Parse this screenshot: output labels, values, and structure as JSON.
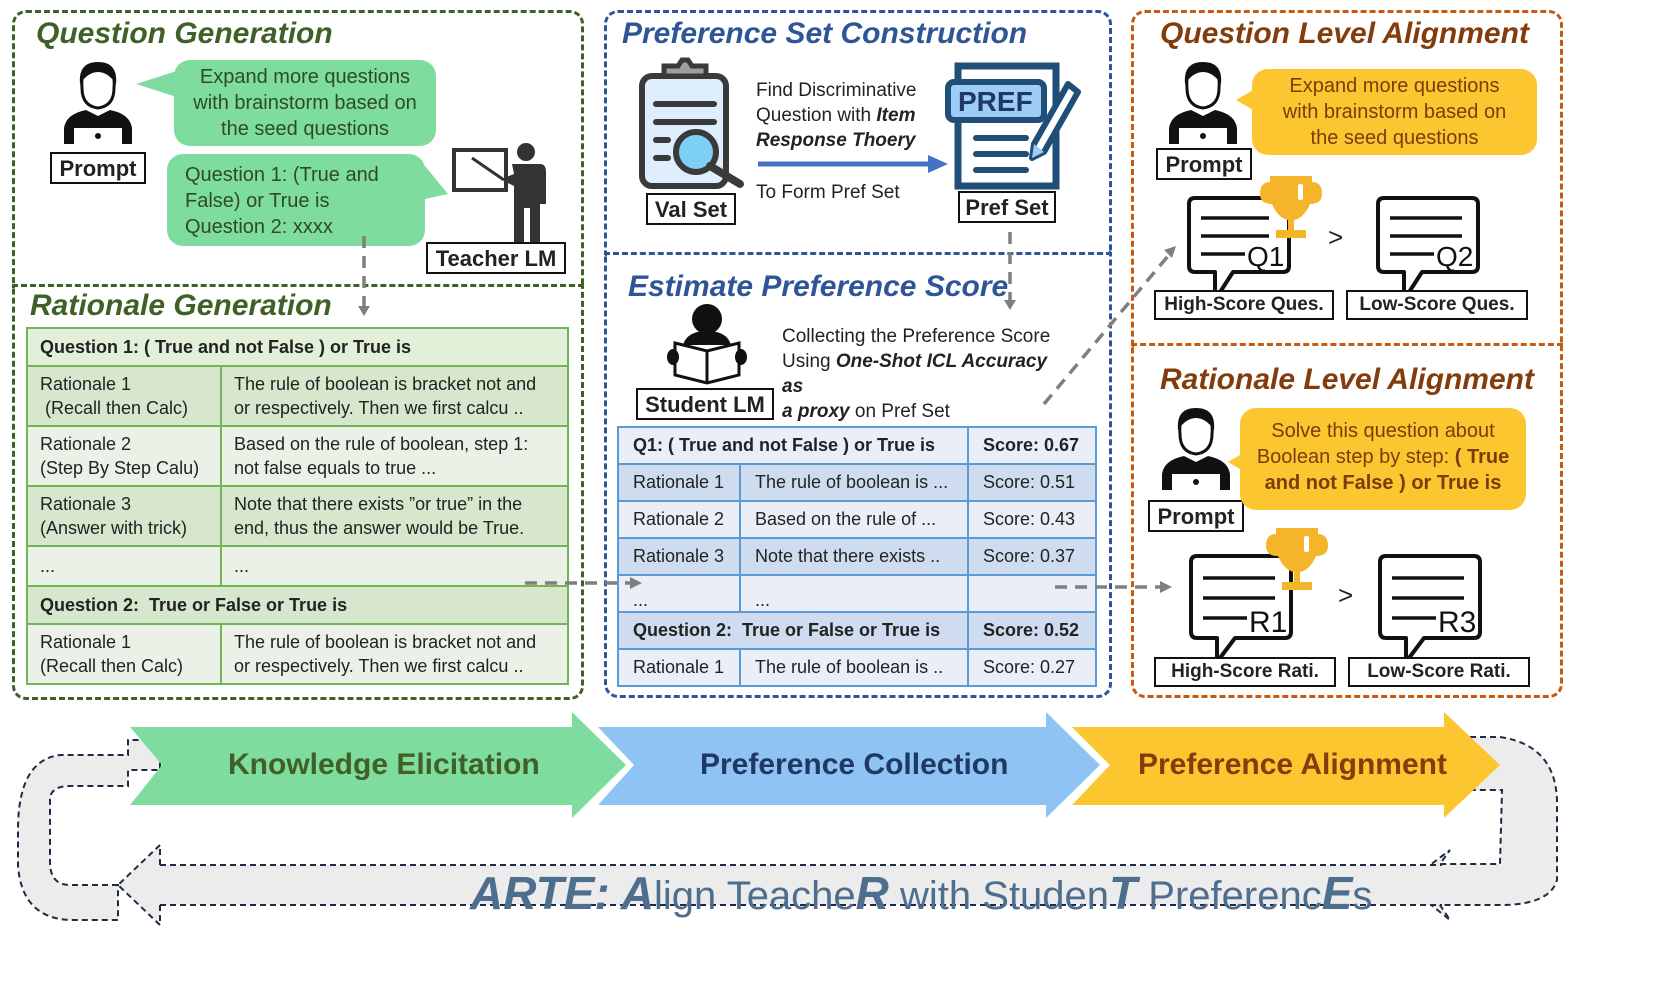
{
  "question_generation": {
    "title": "Question Generation",
    "prompt_label": "Prompt",
    "prompt_bubble": [
      "Expand more questions",
      "with brainstorm based on",
      "the seed questions"
    ],
    "teacher_bubble": [
      "Question 1: (True and",
      "False) or True is",
      "Question 2: xxxx"
    ],
    "teacher_label": "Teacher LM"
  },
  "rationale_generation": {
    "title": "Rationale Generation",
    "rows": [
      {
        "type": "header",
        "text": "Question 1: ( True and not False ) or True is"
      },
      {
        "type": "row",
        "name": [
          "Rationale 1",
          " (Recall then Calc)"
        ],
        "text": [
          "The rule of boolean is bracket not and",
          "or respectively. Then we first calcu .."
        ]
      },
      {
        "type": "row",
        "name": [
          "Rationale 2",
          "(Step By Step Calu)"
        ],
        "text": [
          "Based on the rule of boolean, step 1:",
          "not false equals to true ..."
        ]
      },
      {
        "type": "row",
        "name": [
          "Rationale 3",
          "(Answer with trick)"
        ],
        "text": [
          "Note that there exists ”or true” in the",
          "end, thus the answer would be True."
        ]
      },
      {
        "type": "row",
        "name": [
          "...",
          ""
        ],
        "text": [
          "...",
          ""
        ]
      },
      {
        "type": "header",
        "text": "Question 2:  True or False or True is"
      },
      {
        "type": "row",
        "name": [
          "Rationale 1",
          "(Recall then Calc)"
        ],
        "text": [
          "The rule of boolean is bracket not and",
          "or respectively. Then we first calcu .."
        ]
      }
    ]
  },
  "preference_set_construction": {
    "title": "Preference Set Construction",
    "val_set_label": "Val Set",
    "pref_set_label": "Pref Set",
    "pref_badge": "PREF",
    "arrow_text_line1": "Find Discriminative",
    "arrow_text_line2_plain": "Question with ",
    "arrow_text_line2_bold": "Item",
    "arrow_text_line3_bold": "Response Thoery",
    "arrow_text_below": "To Form Pref Set"
  },
  "estimate_preference_score": {
    "title": "Estimate Preference Score",
    "student_label": "Student LM",
    "desc_line1": "Collecting the Preference Score",
    "desc_line2_plain": "Using ",
    "desc_line2_bold": "One-Shot ICL Accuracy as",
    "desc_line3_bold": "a proxy",
    "desc_line3_plain": " on Pref Set",
    "rows": [
      {
        "type": "header",
        "text": "Q1: ( True and not False ) or True is",
        "score": "Score: 0.67"
      },
      {
        "type": "row",
        "name": "Rationale 1",
        "text": "The rule of boolean is ...",
        "score": "Score: 0.51"
      },
      {
        "type": "row",
        "name": "Rationale 2",
        "text": "Based on the rule of ...",
        "score": "Score: 0.43"
      },
      {
        "type": "row",
        "name": "Rationale 3",
        "text": "Note that there exists ..",
        "score": "Score: 0.37"
      },
      {
        "type": "row",
        "name": "...",
        "text": "...",
        "score": ""
      },
      {
        "type": "header",
        "text": "Question 2:  True or False or True is",
        "score": "Score: 0.52"
      },
      {
        "type": "row",
        "name": "Rationale 1",
        "text": "The rule of boolean is ..",
        "score": "Score: 0.27"
      }
    ]
  },
  "question_level_alignment": {
    "title": "Question Level Alignment",
    "prompt_label": "Prompt",
    "bubble": [
      "Expand more questions",
      "with brainstorm based on",
      "the seed questions"
    ],
    "high_tag": "Q1",
    "low_tag": "Q2",
    "compare": ">",
    "high_label": "High-Score Ques.",
    "low_label": "Low-Score Ques."
  },
  "rationale_level_alignment": {
    "title": "Rationale Level Alignment",
    "prompt_label": "Prompt",
    "bubble_line1": "Solve this question about",
    "bubble_line2_plain": "Boolean step by step: ",
    "bubble_line2_bold": "( True",
    "bubble_line3_bold": "and not False ) or True is",
    "high_tag": "R1",
    "low_tag": "R3",
    "compare": ">",
    "high_label": "High-Score Rati.",
    "low_label": "Low-Score Rati."
  },
  "pipeline": {
    "stages": [
      {
        "label": "Knowledge Elicitation",
        "color": "#7fdc9f",
        "text_color": "#3f6026"
      },
      {
        "label": "Preference Collection",
        "color": "#8ec3f4",
        "text_color": "#1f3864"
      },
      {
        "label": "Preference Alignment",
        "color": "#fbc62f",
        "text_color": "#843c0c"
      }
    ],
    "footer": {
      "b1": "ARTE",
      "p1": ": ",
      "b2": "A",
      "p2": "lign Teache",
      "b3": "R",
      "p3": " with Studen",
      "b4": "T",
      "p4": " Preferenc",
      "b5": "E",
      "p5": "s"
    }
  },
  "colors": {
    "green_border": "#3f6026",
    "blue_border": "#2f5597",
    "orange_border": "#c55a11",
    "green_bubble": "#7fdc9f",
    "yellow_bubble": "#fbc62f",
    "trophy": "#f4b52a"
  }
}
